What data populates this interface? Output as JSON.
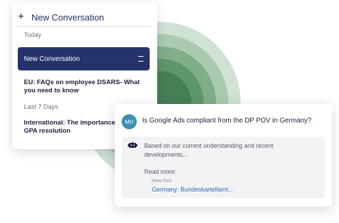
{
  "sidebar": {
    "header_title": "New Conversation",
    "section_today": "Today",
    "active_item": "New Conversation",
    "today_items": [
      "EU: FAQs on employee DSARS- What you need to know"
    ],
    "section_last7": "Last 7 Days",
    "last7_items": [
      "International: The importance of new GPA resolution"
    ]
  },
  "chat": {
    "user_initials": "MH",
    "question": "Is Google Ads compliant from the DP POV in Germany?",
    "answer": "Based on our current understanding and recent developments...",
    "read_more_label": "Read more:",
    "news_type": "News Post",
    "news_link": "Germany: Bundeskartellamt..."
  },
  "colors": {
    "accent_navy": "#26336b",
    "link_blue": "#2a6fb8",
    "avatar": "#3c8fb0",
    "ring_green": "#467f55"
  }
}
